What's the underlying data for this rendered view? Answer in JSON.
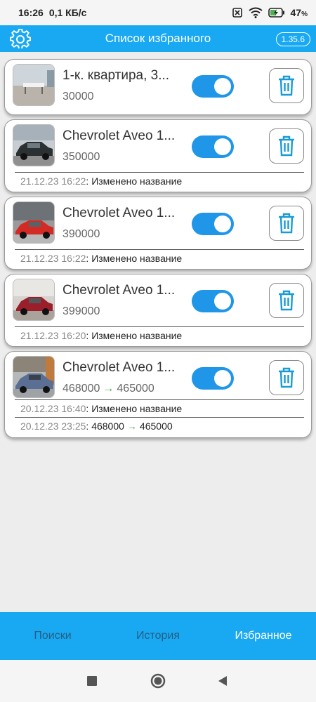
{
  "status_bar": {
    "time": "16:26",
    "net_speed": "0,1 КБ/с",
    "battery": "47",
    "battery_unit": "%"
  },
  "app_bar": {
    "title": "Список избранного",
    "version": "1.35.6",
    "settings_icon": "gear-icon"
  },
  "items": [
    {
      "title": "1-к. квартира, 3...",
      "price": "30000",
      "enabled": true,
      "history": []
    },
    {
      "title": "Chevrolet Aveo 1...",
      "price": "350000",
      "enabled": true,
      "history": [
        {
          "date": "21.12.23 16:22",
          "text": ": Изменено название"
        }
      ]
    },
    {
      "title": "Chevrolet Aveo 1...",
      "price": "390000",
      "enabled": true,
      "history": [
        {
          "date": "21.12.23 16:22",
          "text": ": Изменено название"
        }
      ]
    },
    {
      "title": "Chevrolet Aveo 1...",
      "price": "399000",
      "enabled": true,
      "history": [
        {
          "date": "21.12.23 16:20",
          "text": ": Изменено название"
        }
      ]
    },
    {
      "title": "Chevrolet Aveo 1...",
      "price_old": "468000",
      "price_arrow": "→",
      "price_new": "465000",
      "enabled": true,
      "history": [
        {
          "date": "20.12.23 16:40",
          "text": ": Изменено название"
        },
        {
          "date": "20.12.23 23:25",
          "text": ": 468000",
          "arrow": "→",
          "text_new": "465000"
        }
      ]
    }
  ],
  "bottom_nav": {
    "tabs": [
      {
        "label": "Поиски",
        "active": false
      },
      {
        "label": "История",
        "active": false
      },
      {
        "label": "Избранное",
        "active": true
      }
    ]
  },
  "colors": {
    "accent": "#19a9f2",
    "toggle_on": "#1f96e8",
    "trash": "#1a9ad6",
    "arrow": "#4caf50"
  }
}
